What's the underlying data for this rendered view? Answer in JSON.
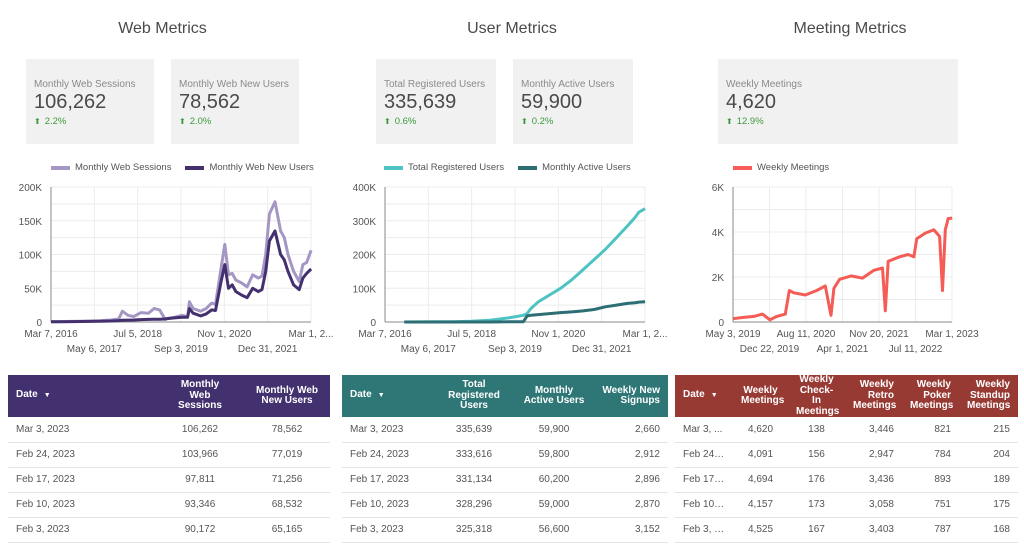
{
  "sections": {
    "web": {
      "title": "Web Metrics"
    },
    "user": {
      "title": "User Metrics"
    },
    "meeting": {
      "title": "Meeting Metrics"
    }
  },
  "scorecards": [
    {
      "label": "Monthly Web Sessions",
      "value": "106,262",
      "delta": "2.2%",
      "direction": "up"
    },
    {
      "label": "Monthly Web New Users",
      "value": "78,562",
      "delta": "2.0%",
      "direction": "up"
    },
    {
      "label": "Total Registered Users",
      "value": "335,639",
      "delta": "0.6%",
      "direction": "up"
    },
    {
      "label": "Monthly Active Users",
      "value": "59,900",
      "delta": "0.2%",
      "direction": "up"
    },
    {
      "label": "Weekly Meetings",
      "value": "4,620",
      "delta": "12.9%",
      "direction": "up"
    }
  ],
  "colors": {
    "web_sessions": "#a597c4",
    "web_new_users": "#44306f",
    "total_registered": "#4fc3c3",
    "monthly_active": "#2c6e73",
    "weekly_meetings": "#f45c55",
    "web_table_header": "#43306f",
    "user_table_header": "#2f7776",
    "meeting_table_header": "#983a34",
    "delta_up": "#3c9a3c"
  },
  "chart_data": [
    {
      "type": "line",
      "title": "Web Metrics",
      "xlabel": "",
      "ylabel": "",
      "x_ticks_row1": [
        "Mar 7, 2016",
        "Jul 5, 2018",
        "Nov 1, 2020",
        "Mar 1, 2..."
      ],
      "x_ticks_row2": [
        "May 6, 2017",
        "Sep 3, 2019",
        "Dec 31, 2021"
      ],
      "y_ticks": [
        "0",
        "50K",
        "100K",
        "150K",
        "200K"
      ],
      "ylim": [
        0,
        200000
      ],
      "xlim": [
        "2016-03-07",
        "2023-03-03"
      ],
      "grid": true,
      "legend": "top",
      "x": [
        2016.18,
        2016.5,
        2017.0,
        2017.5,
        2017.8,
        2018.0,
        2018.1,
        2018.25,
        2018.4,
        2018.6,
        2018.8,
        2018.95,
        2019.1,
        2019.25,
        2019.3,
        2019.5,
        2019.7,
        2019.85,
        2019.9,
        2020.0,
        2020.2,
        2020.35,
        2020.5,
        2020.6,
        2020.75,
        2020.85,
        2020.95,
        2021.05,
        2021.15,
        2021.3,
        2021.45,
        2021.6,
        2021.75,
        2021.85,
        2021.95,
        2022.05,
        2022.2,
        2022.35,
        2022.45,
        2022.55,
        2022.7,
        2022.85,
        2022.95,
        2023.05,
        2023.17
      ],
      "series": [
        {
          "name": "Monthly Web Sessions",
          "values": [
            500,
            800,
            1200,
            1800,
            3000,
            4500,
            16000,
            10000,
            8000,
            14000,
            13000,
            20000,
            18000,
            4000,
            5000,
            7000,
            10000,
            8000,
            30000,
            20000,
            16000,
            20000,
            28000,
            26000,
            80000,
            115000,
            70000,
            72000,
            62000,
            58000,
            52000,
            70000,
            65000,
            68000,
            100000,
            160000,
            178000,
            135000,
            125000,
            100000,
            75000,
            60000,
            85000,
            88000,
            106262
          ]
        },
        {
          "name": "Monthly Web New Users",
          "values": [
            300,
            500,
            700,
            1000,
            1500,
            2000,
            2500,
            2800,
            3000,
            3500,
            3800,
            4000,
            4200,
            4500,
            5000,
            6000,
            7000,
            7000,
            20000,
            13000,
            9000,
            12000,
            18000,
            17000,
            60000,
            85000,
            50000,
            55000,
            45000,
            40000,
            36000,
            50000,
            45000,
            48000,
            75000,
            120000,
            135000,
            100000,
            92000,
            75000,
            55000,
            48000,
            65000,
            72000,
            78562
          ]
        }
      ]
    },
    {
      "type": "line",
      "title": "User Metrics",
      "xlabel": "",
      "ylabel": "",
      "x_ticks_row1": [
        "Mar 7, 2016",
        "Jul 5, 2018",
        "Nov 1, 2020",
        "Mar 1, 2..."
      ],
      "x_ticks_row2": [
        "May 6, 2017",
        "Sep 3, 2019",
        "Dec 31, 2021"
      ],
      "y_ticks": [
        "0",
        "100K",
        "200K",
        "300K",
        "400K"
      ],
      "ylim": [
        0,
        400000
      ],
      "xlim": [
        "2016-03-07",
        "2023-03-03"
      ],
      "grid": true,
      "legend": "top",
      "x": [
        2016.7,
        2017.0,
        2017.5,
        2018.0,
        2018.5,
        2019.0,
        2019.5,
        2019.9,
        2020.0,
        2020.1,
        2020.3,
        2020.6,
        2020.9,
        2021.2,
        2021.5,
        2021.8,
        2022.1,
        2022.4,
        2022.7,
        2022.9,
        2023.0,
        2023.17
      ],
      "series": [
        {
          "name": "Total Registered Users",
          "values": [
            0,
            200,
            500,
            1000,
            2000,
            5000,
            12000,
            20000,
            25000,
            40000,
            60000,
            80000,
            100000,
            125000,
            155000,
            185000,
            215000,
            250000,
            285000,
            310000,
            325318,
            335639
          ]
        },
        {
          "name": "Monthly Active Users",
          "values": [
            0,
            0,
            0,
            0,
            0,
            0,
            500,
            1000,
            18000,
            20000,
            22000,
            25000,
            28000,
            30000,
            33000,
            37000,
            45000,
            50000,
            55000,
            57000,
            59000,
            59900
          ]
        }
      ]
    },
    {
      "type": "line",
      "title": "Meeting Metrics",
      "xlabel": "",
      "ylabel": "",
      "x_ticks_row1": [
        "May 3, 2019",
        "Aug 11, 2020",
        "Nov 20, 2021",
        "Mar 1, 2023"
      ],
      "x_ticks_row2": [
        "Dec 22, 2019",
        "Apr 1, 2021",
        "Jul 11, 2022"
      ],
      "y_ticks": [
        "0",
        "2K",
        "4K",
        "6K"
      ],
      "ylim": [
        0,
        6000
      ],
      "xlim": [
        "2019-05-03",
        "2023-03-03"
      ],
      "grid": true,
      "legend": "top",
      "x": [
        2019.34,
        2019.5,
        2019.7,
        2019.85,
        2019.98,
        2020.1,
        2020.25,
        2020.32,
        2020.4,
        2020.6,
        2020.8,
        2020.95,
        2021.05,
        2021.1,
        2021.2,
        2021.4,
        2021.6,
        2021.8,
        2021.95,
        2022.0,
        2022.05,
        2022.25,
        2022.4,
        2022.5,
        2022.55,
        2022.7,
        2022.85,
        2022.95,
        2023.0,
        2023.05,
        2023.1,
        2023.17
      ],
      "series": [
        {
          "name": "Weekly Meetings",
          "values": [
            150,
            200,
            250,
            350,
            100,
            250,
            350,
            1400,
            1300,
            1200,
            1400,
            1600,
            300,
            1500,
            1900,
            2050,
            1950,
            2300,
            2400,
            500,
            2700,
            2900,
            3000,
            2900,
            3700,
            3950,
            4100,
            3800,
            1400,
            4100,
            4600,
            4620
          ]
        }
      ]
    }
  ],
  "tables": {
    "web": {
      "headers": [
        "Date",
        "Monthly Web Sessions",
        "Monthly Web New Users"
      ],
      "header_lines": [
        [
          "Date"
        ],
        [
          "Monthly",
          "Web",
          "Sessions"
        ],
        [
          "Monthly Web",
          "New Users"
        ]
      ],
      "rows": [
        [
          "Mar 3, 2023",
          "106,262",
          "78,562"
        ],
        [
          "Feb 24, 2023",
          "103,966",
          "77,019"
        ],
        [
          "Feb 17, 2023",
          "97,811",
          "71,256"
        ],
        [
          "Feb 10, 2023",
          "93,346",
          "68,532"
        ],
        [
          "Feb 3, 2023",
          "90,172",
          "65,165"
        ]
      ]
    },
    "user": {
      "headers": [
        "Date",
        "Total Registered Users",
        "Monthly Active Users",
        "Weekly New Signups"
      ],
      "header_lines": [
        [
          "Date"
        ],
        [
          "Total",
          "Registered",
          "Users"
        ],
        [
          "Monthly",
          "Active Users"
        ],
        [
          "Weekly New",
          "Signups"
        ]
      ],
      "rows": [
        [
          "Mar 3, 2023",
          "335,639",
          "59,900",
          "2,660"
        ],
        [
          "Feb 24, 2023",
          "333,616",
          "59,800",
          "2,912"
        ],
        [
          "Feb 17, 2023",
          "331,134",
          "60,200",
          "2,896"
        ],
        [
          "Feb 10, 2023",
          "328,296",
          "59,000",
          "2,870"
        ],
        [
          "Feb 3, 2023",
          "325,318",
          "56,600",
          "3,152"
        ]
      ]
    },
    "meeting": {
      "headers": [
        "Date",
        "Weekly Meetings",
        "Weekly Check-In Meetings",
        "Weekly Retro Meetings",
        "Weekly Poker Meetings",
        "Weekly Standup Meetings"
      ],
      "header_lines": [
        [
          "Date"
        ],
        [
          "Weekly",
          "Meetings"
        ],
        [
          "Weekly",
          "Check-In",
          "Meetings"
        ],
        [
          "Weekly",
          "Retro",
          "Meetings"
        ],
        [
          "Weekly",
          "Poker",
          "Meetings"
        ],
        [
          "Weekly",
          "Standup",
          "Meetings"
        ]
      ],
      "rows": [
        [
          "Mar 3, ...",
          "4,620",
          "138",
          "3,446",
          "821",
          "215"
        ],
        [
          "Feb 24, ...",
          "4,091",
          "156",
          "2,947",
          "784",
          "204"
        ],
        [
          "Feb 17, ...",
          "4,694",
          "176",
          "3,436",
          "893",
          "189"
        ],
        [
          "Feb 10, ...",
          "4,157",
          "173",
          "3,058",
          "751",
          "175"
        ],
        [
          "Feb 3, 2...",
          "4,525",
          "167",
          "3,403",
          "787",
          "168"
        ]
      ]
    }
  },
  "icons": {
    "delta_up": "arrow-up-icon",
    "sort": "sort-desc-icon"
  }
}
